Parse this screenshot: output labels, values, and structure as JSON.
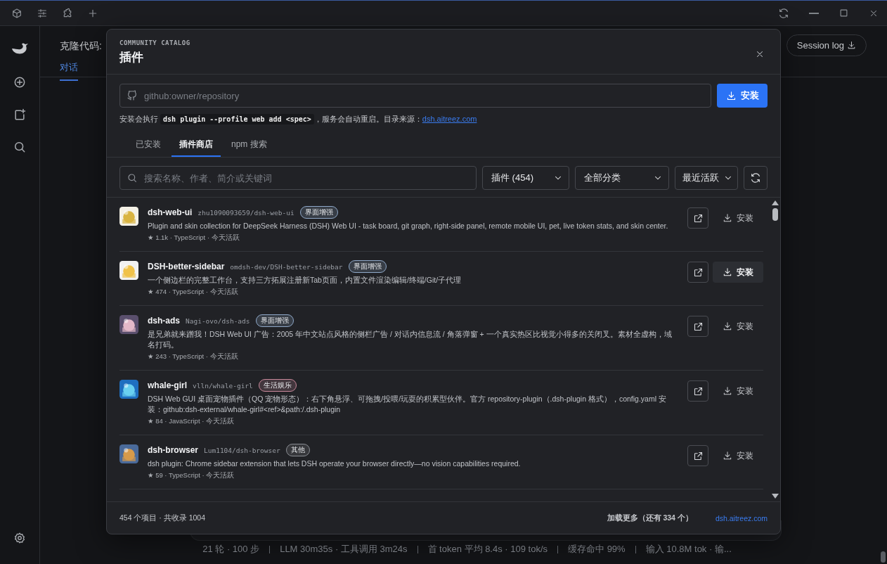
{
  "app": {
    "header_title": "克隆代码:",
    "tabs": [
      {
        "label": "对话",
        "selected": true
      }
    ],
    "session_log": "Session log",
    "stats": [
      "21 轮 · 100 步",
      "LLM 30m35s · 工具调用 3m24s",
      "首 token 平均 8.4s · 109 tok/s",
      "缓存命中 99%",
      "输入 10.8M tok · 输..."
    ]
  },
  "dialog": {
    "eyebrow": "COMMUNITY CATALOG",
    "title": "插件",
    "install": {
      "placeholder": "github:owner/repository",
      "button": "安装"
    },
    "hint": {
      "before": "安装会执行",
      "code": "dsh plugin --profile web add <spec>",
      "after": "，服务会自动重启。目录来源：",
      "link": "dsh.aitreez.com"
    },
    "tabs": [
      {
        "label": "已安装",
        "selected": false
      },
      {
        "label": "插件商店",
        "selected": true
      },
      {
        "label": "npm 搜索",
        "selected": false
      }
    ],
    "search": {
      "placeholder": "搜索名称、作者、简介或关键词"
    },
    "filters": [
      "插件 (454)",
      "全部分类",
      "最近活跃"
    ],
    "plugins": [
      {
        "name": "dsh-web-ui",
        "repo": "zhu1090093659/dsh-web-ui",
        "tag": "界面增强",
        "color": "#8fa8c8",
        "description": "Plugin and skin collection for DeepSeek Harness (DSH) Web UI - task board, git graph, right-side panel, remote mobile UI, pet, live token stats, and skin center.",
        "meta": "★ 1.1k · TypeScript · 今天活跃",
        "install": "安装",
        "highlighted": false,
        "kind": "picture"
      },
      {
        "name": "DSH-better-sidebar",
        "repo": "omdsh-dev/DSH-better-sidebar",
        "tag": "界面增强",
        "color": "#8fa8c8",
        "description": "一个侧边栏的完整工作台，支持三方拓展注册新Tab页面，内置文件渲染编辑/终端/Git/子代理",
        "meta": "★ 474 · TypeScript · 今天活跃",
        "install": "安装",
        "highlighted": true,
        "kind": "picture"
      },
      {
        "name": "dsh-ads",
        "repo": "Nagi-ovo/dsh-ads",
        "tag": "界面增强",
        "color": "#8fa8c8",
        "description": "是兄弟就来蹭我！DSH Web UI 广告：2005 年中文站点风格的侧栏广告 / 对话内信息流 / 角落弹窗 + 一个真实热区比视觉小得多的关闭叉。素材全虚构，域名打码。",
        "meta": "★ 243 · TypeScript · 今天活跃",
        "install": "安装",
        "highlighted": false,
        "kind": "picture"
      },
      {
        "name": "whale-girl",
        "repo": "vlln/whale-girl",
        "tag": "生活娱乐",
        "color": "#c8889a",
        "description": "DSH Web GUI 桌面宠物插件（QQ 宠物形态）：右下角悬浮、可拖拽/投喂/玩耍的积累型伙伴。官方 repository-plugin（.dsh-plugin 格式），config.yaml 安装：github:dsh-external/whale-girl#<ref>&path:/.dsh-plugin",
        "meta": "★ 84 · JavaScript · 今天活跃",
        "install": "安装",
        "highlighted": false,
        "kind": "picture"
      },
      {
        "name": "dsh-browser",
        "repo": "Lum1104/dsh-browser",
        "tag": "其他",
        "color": "#8a8d93",
        "description": "dsh plugin: Chrome sidebar extension that lets DSH operate your browser directly—no vision capabilities required.",
        "meta": "★ 59 · TypeScript · 今天活跃",
        "install": "安装",
        "highlighted": false,
        "kind": "picture"
      }
    ],
    "footer": {
      "count": "454 个项目 · 共收录 1004",
      "load_more": "加载更多（还有 334 个）",
      "link": "dsh.aitreez.com"
    }
  }
}
